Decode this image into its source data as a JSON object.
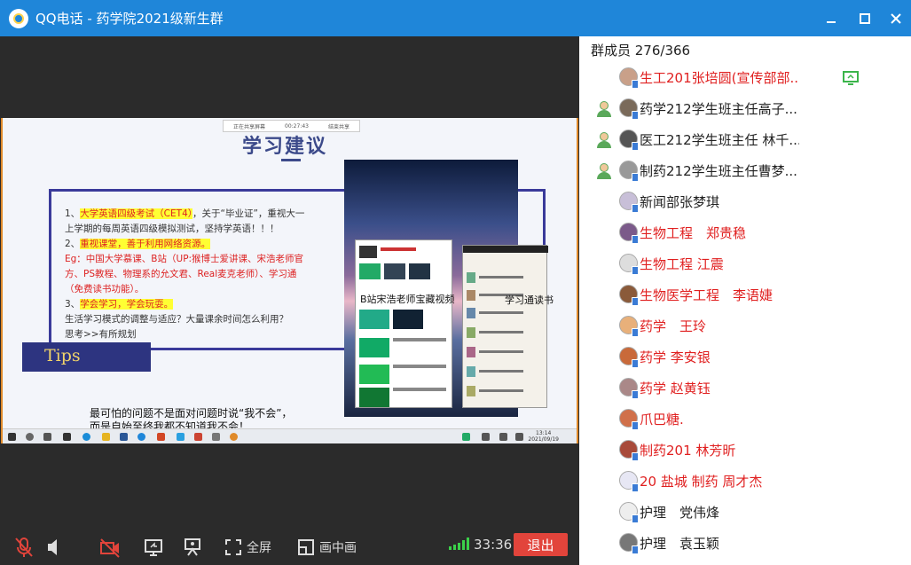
{
  "titlebar": {
    "title": "QQ电话 - 药学院2021级新生群",
    "minimize_icon": "minimize-icon",
    "maximize_icon": "maximize-icon",
    "close_icon": "close-icon"
  },
  "shared_screen": {
    "top_strip": [
      "正在共享屏幕",
      "00:27:43",
      "结束共享"
    ],
    "heading": "学习建议",
    "text_lines": [
      {
        "prefix": "1、",
        "highlight": "大学英语四级考试（CET4）",
        "rest": "，关于“毕业证”，重视大一"
      },
      {
        "prefix": "",
        "highlight": "",
        "rest": "上学期的每周英语四级模拟测试，坚持学英语！！！"
      },
      {
        "prefix": "2、",
        "highlight": "重视课堂，善于利用网络资源。",
        "rest": ""
      },
      {
        "prefix": "",
        "highlight": "",
        "red": "Eg：中国大学慕课、B站（UP:猴博士爱讲课、宋浩老师官"
      },
      {
        "prefix": "",
        "highlight": "",
        "red": "方、PS教程、物理系的允文君、Real麦克老师）、学习通"
      },
      {
        "prefix": "",
        "highlight": "",
        "red": "（免费读书功能）。"
      },
      {
        "prefix": "3、",
        "highlight": "学会学习，学会玩耍。",
        "rest": ""
      },
      {
        "prefix": "",
        "highlight": "",
        "rest": "    生活学习模式的调整与适应？大量课余时间怎么利用？"
      },
      {
        "prefix": "",
        "highlight": "",
        "rest": "    思考>>有所规划"
      }
    ],
    "tips_label": "Tips",
    "caption_bilibili": "B站宋浩老师宝藏视频",
    "caption_xuexitong": "学习通读书",
    "bottom_text": [
      "最可怕的问题不是面对问题时说“我不会”，",
      "而是自始至终我都不知道我不会！"
    ],
    "taskbar_time": "13:14",
    "taskbar_date": "2021/09/19"
  },
  "controls": {
    "mic_icon": "mic-muted-icon",
    "speaker_icon": "speaker-icon",
    "camera_icon": "camera-off-icon",
    "screen_share_icon": "screen-share-icon",
    "presenter_icon": "presenter-icon",
    "fullscreen_label": "全屏",
    "pip_label": "画中画",
    "duration": "33:36",
    "hangup_label": "退出"
  },
  "member_panel": {
    "count_label": "群成员 276/366",
    "members": [
      {
        "name": "生工201张培圆(宣传部部...",
        "color": "red",
        "role": "",
        "sharing": true
      },
      {
        "name": "药学212学生班主任高子...",
        "color": "black",
        "role": "admin",
        "sharing": false
      },
      {
        "name": "医工212学生班主任 林千...",
        "color": "black",
        "role": "admin",
        "sharing": false
      },
      {
        "name": "制药212学生班主任曹梦...",
        "color": "black",
        "role": "admin",
        "sharing": false
      },
      {
        "name": "新闻部张梦琪",
        "color": "black",
        "role": "",
        "sharing": false
      },
      {
        "name": "生物工程　郑贵稳",
        "color": "red",
        "role": "",
        "sharing": false
      },
      {
        "name": "生物工程 江震",
        "color": "red",
        "role": "",
        "sharing": false
      },
      {
        "name": "生物医学工程　李语婕",
        "color": "red",
        "role": "",
        "sharing": false
      },
      {
        "name": "药学　王玲",
        "color": "red",
        "role": "",
        "sharing": false
      },
      {
        "name": "药学 李安银",
        "color": "red",
        "role": "",
        "sharing": false
      },
      {
        "name": "药学 赵黄钰",
        "color": "red",
        "role": "",
        "sharing": false
      },
      {
        "name": "爪巴糖.",
        "color": "red",
        "role": "",
        "sharing": false
      },
      {
        "name": "制药201 林芳昕",
        "color": "red",
        "role": "",
        "sharing": false
      },
      {
        "name": "20 盐城 制药 周才杰",
        "color": "red",
        "role": "",
        "sharing": false
      },
      {
        "name": "护理　党伟烽",
        "color": "black",
        "role": "",
        "sharing": false
      },
      {
        "name": "护理　袁玉颖",
        "color": "black",
        "role": "",
        "sharing": false
      }
    ]
  },
  "colors": {
    "titlebar": "#1f86d9",
    "hangup": "#e2443b",
    "signal": "#3bd14a",
    "highlight_name": "#e02020"
  }
}
